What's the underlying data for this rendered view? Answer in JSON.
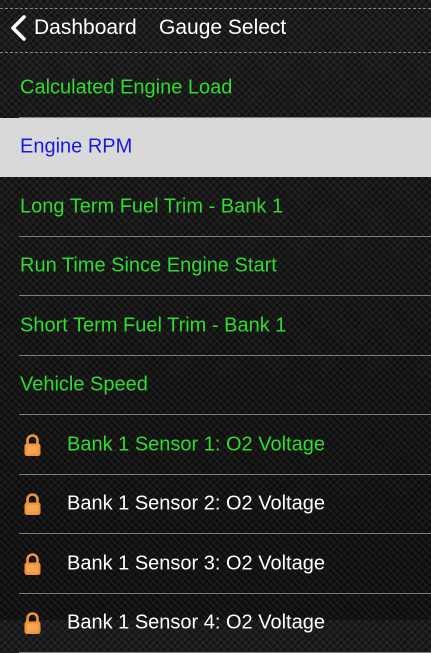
{
  "nav": {
    "back_label": "Dashboard",
    "title": "Gauge Select",
    "back_icon": "chevron-left-icon"
  },
  "colors": {
    "unlocked_text": "#2fdc2f",
    "selected_text": "#1a1adb",
    "selected_background": "#d9d9d9",
    "locked_text": "#ffffff",
    "lock_icon": "#f0953b"
  },
  "gauges": [
    {
      "label": "Calculated Engine Load",
      "locked": false,
      "selected": false
    },
    {
      "label": "Engine RPM",
      "locked": false,
      "selected": true
    },
    {
      "label": "Long Term Fuel Trim - Bank 1",
      "locked": false,
      "selected": false
    },
    {
      "label": "Run Time Since Engine Start",
      "locked": false,
      "selected": false
    },
    {
      "label": "Short Term Fuel Trim - Bank 1",
      "locked": false,
      "selected": false
    },
    {
      "label": "Vehicle Speed",
      "locked": false,
      "selected": false
    },
    {
      "label": "Bank 1 Sensor 1: O2 Voltage",
      "locked": true,
      "selected": false
    },
    {
      "label": "Bank 1 Sensor 2: O2 Voltage",
      "locked": true,
      "selected": false
    },
    {
      "label": "Bank 1 Sensor 3: O2 Voltage",
      "locked": true,
      "selected": false
    },
    {
      "label": "Bank 1 Sensor 4: O2 Voltage",
      "locked": true,
      "selected": false
    }
  ]
}
